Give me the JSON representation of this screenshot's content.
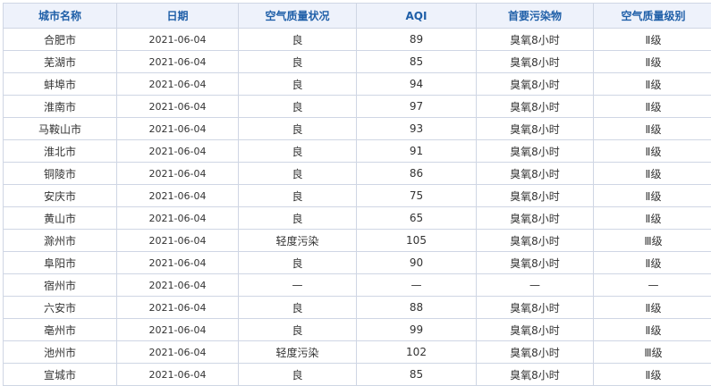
{
  "table": {
    "headers": [
      "城市名称",
      "日期",
      "空气质量状况",
      "AQI",
      "首要污染物",
      "空气质量级别"
    ],
    "rows": [
      [
        "合肥市",
        "2021-06-04",
        "良",
        "89",
        "臭氧8小时",
        "Ⅱ级"
      ],
      [
        "芜湖市",
        "2021-06-04",
        "良",
        "85",
        "臭氧8小时",
        "Ⅱ级"
      ],
      [
        "蚌埠市",
        "2021-06-04",
        "良",
        "94",
        "臭氧8小时",
        "Ⅱ级"
      ],
      [
        "淮南市",
        "2021-06-04",
        "良",
        "97",
        "臭氧8小时",
        "Ⅱ级"
      ],
      [
        "马鞍山市",
        "2021-06-04",
        "良",
        "93",
        "臭氧8小时",
        "Ⅱ级"
      ],
      [
        "淮北市",
        "2021-06-04",
        "良",
        "91",
        "臭氧8小时",
        "Ⅱ级"
      ],
      [
        "铜陵市",
        "2021-06-04",
        "良",
        "86",
        "臭氧8小时",
        "Ⅱ级"
      ],
      [
        "安庆市",
        "2021-06-04",
        "良",
        "75",
        "臭氧8小时",
        "Ⅱ级"
      ],
      [
        "黄山市",
        "2021-06-04",
        "良",
        "65",
        "臭氧8小时",
        "Ⅱ级"
      ],
      [
        "滁州市",
        "2021-06-04",
        "轻度污染",
        "105",
        "臭氧8小时",
        "Ⅲ级"
      ],
      [
        "阜阳市",
        "2021-06-04",
        "良",
        "90",
        "臭氧8小时",
        "Ⅱ级"
      ],
      [
        "宿州市",
        "2021-06-04",
        "—",
        "—",
        "—",
        "—"
      ],
      [
        "六安市",
        "2021-06-04",
        "良",
        "88",
        "臭氧8小时",
        "Ⅱ级"
      ],
      [
        "亳州市",
        "2021-06-04",
        "良",
        "99",
        "臭氧8小时",
        "Ⅱ级"
      ],
      [
        "池州市",
        "2021-06-04",
        "轻度污染",
        "102",
        "臭氧8小时",
        "Ⅲ级"
      ],
      [
        "宣城市",
        "2021-06-04",
        "良",
        "85",
        "臭氧8小时",
        "Ⅱ级"
      ]
    ]
  },
  "colors": {
    "header_text": "#1f5fa8",
    "header_bg": "#eef2fb",
    "border": "#cfd6e4",
    "cell_text": "#333333"
  }
}
